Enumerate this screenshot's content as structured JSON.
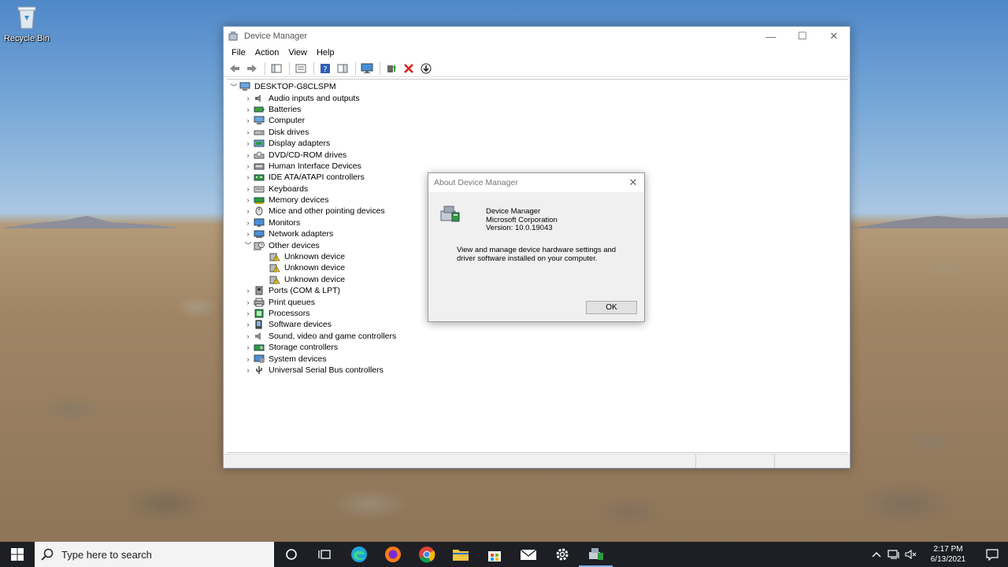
{
  "desktop": {
    "recycle_bin_label": "Recycle Bin"
  },
  "window": {
    "title": "Device Manager",
    "controls": {
      "minimize": "—",
      "maximize": "☐",
      "close": "✕"
    },
    "menu": [
      "File",
      "Action",
      "View",
      "Help"
    ]
  },
  "tree": {
    "root": "DESKTOP-G8CLSPM",
    "items": [
      {
        "label": "Audio inputs and outputs",
        "icon": "speaker-icon",
        "expanded": false
      },
      {
        "label": "Batteries",
        "icon": "battery-icon",
        "expanded": false
      },
      {
        "label": "Computer",
        "icon": "computer-icon",
        "expanded": false
      },
      {
        "label": "Disk drives",
        "icon": "disk-drive-icon",
        "expanded": false
      },
      {
        "label": "Display adapters",
        "icon": "display-adapter-icon",
        "expanded": false
      },
      {
        "label": "DVD/CD-ROM drives",
        "icon": "dvd-icon",
        "expanded": false
      },
      {
        "label": "Human Interface Devices",
        "icon": "hid-icon",
        "expanded": false
      },
      {
        "label": "IDE ATA/ATAPI controllers",
        "icon": "ide-controller-icon",
        "expanded": false
      },
      {
        "label": "Keyboards",
        "icon": "keyboard-icon",
        "expanded": false
      },
      {
        "label": "Memory devices",
        "icon": "memory-icon",
        "expanded": false
      },
      {
        "label": "Mice and other pointing devices",
        "icon": "mouse-icon",
        "expanded": false
      },
      {
        "label": "Monitors",
        "icon": "monitor-icon",
        "expanded": false
      },
      {
        "label": "Network adapters",
        "icon": "network-adapter-icon",
        "expanded": false
      },
      {
        "label": "Other devices",
        "icon": "other-devices-icon",
        "expanded": true,
        "children": [
          "Unknown device",
          "Unknown device",
          "Unknown device"
        ]
      },
      {
        "label": "Ports (COM & LPT)",
        "icon": "port-icon",
        "expanded": false
      },
      {
        "label": "Print queues",
        "icon": "printer-icon",
        "expanded": false
      },
      {
        "label": "Processors",
        "icon": "processor-icon",
        "expanded": false
      },
      {
        "label": "Software devices",
        "icon": "software-device-icon",
        "expanded": false
      },
      {
        "label": "Sound, video and game controllers",
        "icon": "sound-controller-icon",
        "expanded": false
      },
      {
        "label": "Storage controllers",
        "icon": "storage-controller-icon",
        "expanded": false
      },
      {
        "label": "System devices",
        "icon": "system-device-icon",
        "expanded": false
      },
      {
        "label": "Universal Serial Bus controllers",
        "icon": "usb-icon",
        "expanded": false
      }
    ]
  },
  "about": {
    "title": "About Device Manager",
    "close": "✕",
    "product": "Device Manager",
    "company": "Microsoft Corporation",
    "version": "Version: 10.0.19043",
    "description": "View and manage device hardware settings and driver software installed on your computer.",
    "ok_label": "OK"
  },
  "taskbar": {
    "search_placeholder": "Type here to search",
    "time": "2:17 PM",
    "date": "6/13/2021"
  }
}
